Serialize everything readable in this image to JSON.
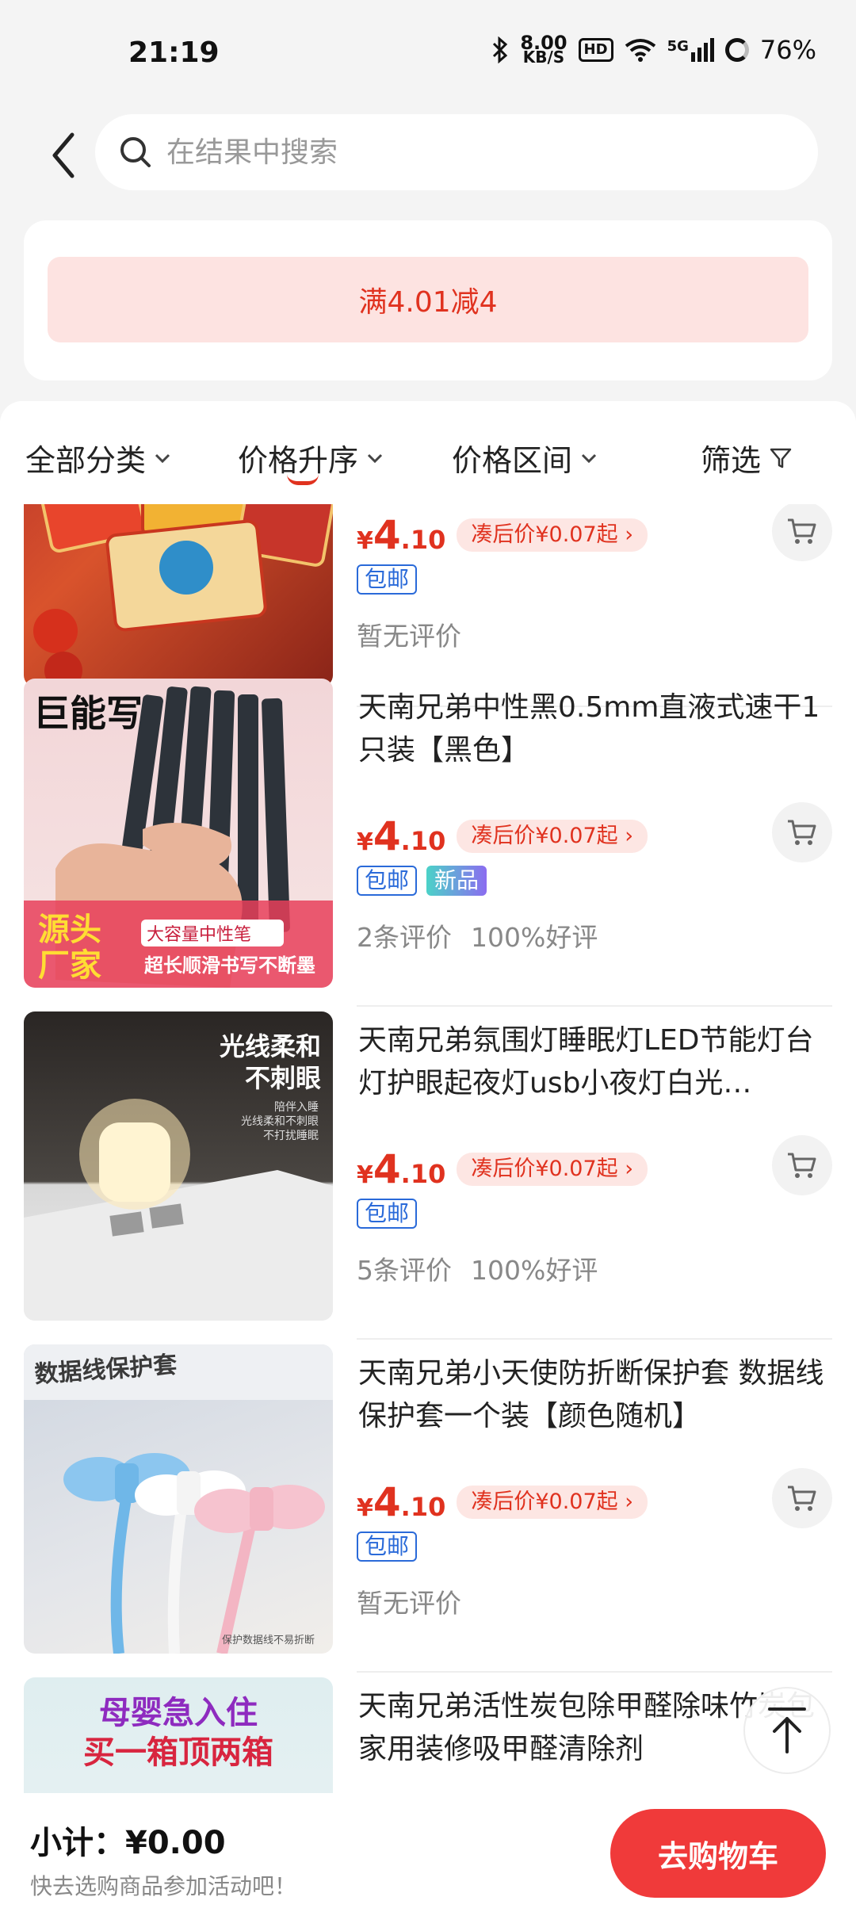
{
  "status": {
    "time": "21:19",
    "speed_value": "8.00",
    "speed_unit": "KB/S",
    "hd": "HD",
    "network": "5G",
    "battery": "76%"
  },
  "search": {
    "placeholder": "在结果中搜索"
  },
  "promo": {
    "text": "满4.01减4"
  },
  "filters": {
    "all_categories": "全部分类",
    "price_sort": "价格升序",
    "price_range": "价格区间",
    "filter": "筛选"
  },
  "products": [
    {
      "title": "",
      "price_currency": "¥",
      "price_int": "4",
      "price_dec": ".10",
      "after_price": "凑后价¥0.07起",
      "badges": [
        "包邮"
      ],
      "review_count": "暂无评价",
      "review_rate": ""
    },
    {
      "title": "天南兄弟中性黑0.5mm直液式速干1只装【黑色】",
      "price_currency": "¥",
      "price_int": "4",
      "price_dec": ".10",
      "after_price": "凑后价¥0.07起",
      "badges": [
        "包邮",
        "新品"
      ],
      "review_count": "2条评价",
      "review_rate": "100%好评",
      "image_text": [
        "巨能写",
        "源头",
        "厂家",
        "大容量中性笔",
        "超长顺滑书写不断墨"
      ]
    },
    {
      "title": "天南兄弟氛围灯睡眠灯LED节能灯台灯护眼起夜灯usb小夜灯白光…",
      "price_currency": "¥",
      "price_int": "4",
      "price_dec": ".10",
      "after_price": "凑后价¥0.07起",
      "badges": [
        "包邮"
      ],
      "review_count": "5条评价",
      "review_rate": "100%好评",
      "image_text": [
        "光线柔和",
        "不刺眼",
        "陪伴入睡",
        "光线柔和不刺眼",
        "不打扰睡眠"
      ]
    },
    {
      "title": "天南兄弟小天使防折断保护套 数据线保护套一个装【颜色随机】",
      "price_currency": "¥",
      "price_int": "4",
      "price_dec": ".10",
      "after_price": "凑后价¥0.07起",
      "badges": [
        "包邮"
      ],
      "review_count": "暂无评价",
      "review_rate": "",
      "image_text": [
        "数据线保护套",
        "保护数据线不易折断"
      ]
    },
    {
      "title": "天南兄弟活性炭包除甲醛除味竹炭包家用装修吸甲醛清除剂",
      "image_text": [
        "母婴急入住",
        "买一箱顶两箱"
      ]
    }
  ],
  "bottom": {
    "subtotal": "小计：¥0.00",
    "hint": "快去选购商品参加活动吧！",
    "go_cart": "去购物车"
  },
  "colors": {
    "accent": "#e0321f",
    "ship_badge": "#2a6ad9",
    "cart_button": "#f03a3a"
  }
}
